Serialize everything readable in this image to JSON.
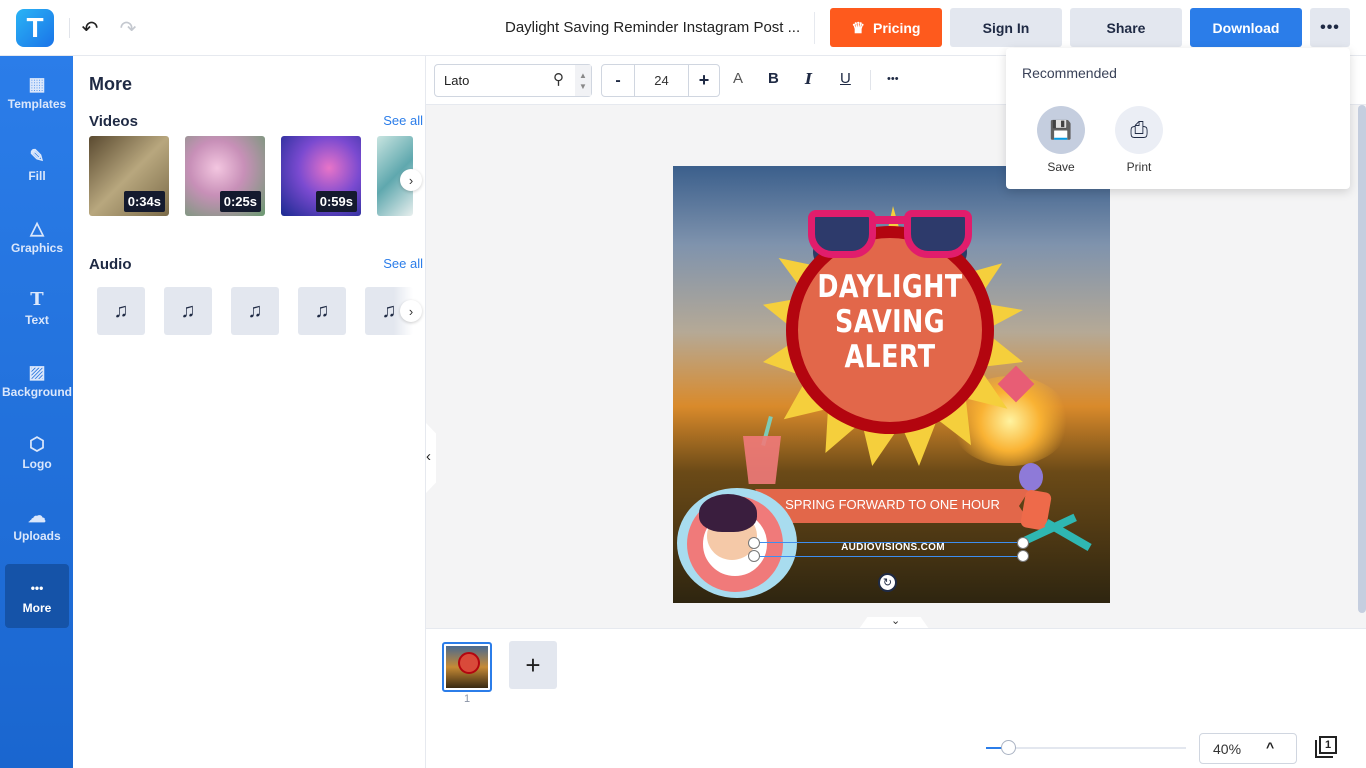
{
  "app": {
    "logo_letter": "T"
  },
  "header": {
    "undo_icon": "↶",
    "redo_icon": "↷",
    "document_title": "Daylight Saving Reminder Instagram Post ...",
    "pricing_label": "Pricing",
    "pricing_icon": "♛",
    "signin_label": "Sign In",
    "share_label": "Share",
    "download_label": "Download",
    "more_label": "•••"
  },
  "sidebar": {
    "items": [
      {
        "label": "Templates",
        "icon": "▦"
      },
      {
        "label": "Fill",
        "icon": "✎"
      },
      {
        "label": "Graphics",
        "icon": "△"
      },
      {
        "label": "Text",
        "icon": "T"
      },
      {
        "label": "Background",
        "icon": "▨"
      },
      {
        "label": "Logo",
        "icon": "⬡"
      },
      {
        "label": "Uploads",
        "icon": "☁"
      },
      {
        "label": "More",
        "icon": "•••"
      }
    ],
    "active": "More"
  },
  "panel": {
    "title": "More",
    "videos": {
      "title": "Videos",
      "see_all": "See all",
      "items": [
        {
          "duration": "0:34s",
          "color": "#8c7a58"
        },
        {
          "duration": "0:25s",
          "color": "#c890b8"
        },
        {
          "duration": "0:59s",
          "color": "#7a4ad0"
        },
        {
          "duration": "",
          "color": "#7fb8bc"
        }
      ]
    },
    "audio": {
      "title": "Audio",
      "see_all": "See all",
      "items": [
        "♫",
        "♫",
        "♫",
        "♫",
        "♫"
      ]
    },
    "next_icon": "›"
  },
  "toolbar": {
    "font_name": "Lato",
    "search_icon": "⚲",
    "font_size": "24",
    "minus": "-",
    "plus": "+",
    "color_icon": "A",
    "bold_icon": "B",
    "italic_icon": "I",
    "underline_icon": "U",
    "more_icon": "•••"
  },
  "design": {
    "headline": [
      "DAYLIGHT",
      "SAVING",
      "ALERT"
    ],
    "banner": "SPRING FORWARD TO ONE HOUR",
    "url": "AUDIOVISIONS.COM"
  },
  "dropdown": {
    "title": "Recommended",
    "items": [
      {
        "label": "Save",
        "icon": "💾"
      },
      {
        "label": "Print",
        "icon": "⎙"
      }
    ]
  },
  "pages": {
    "current": "1",
    "add_icon": "+"
  },
  "zoom": {
    "value": "40%",
    "slider_fraction": 0.11,
    "up_icon": "^",
    "page_count": "1"
  },
  "colors": {
    "accent": "#2b7de9",
    "pricing": "#fe5a1d"
  }
}
